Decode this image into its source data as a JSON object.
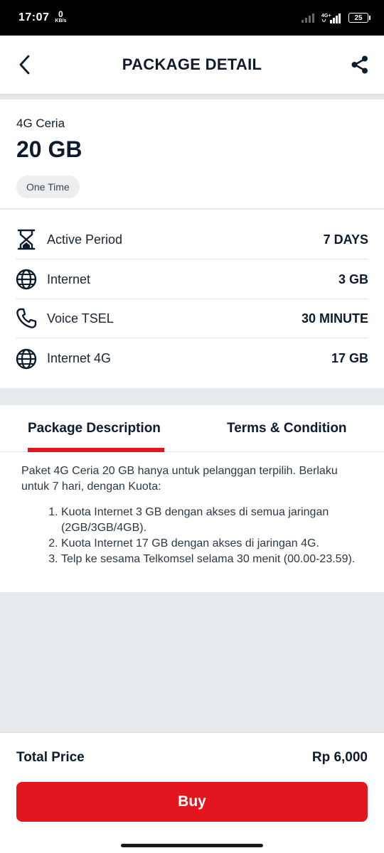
{
  "status_bar": {
    "time": "17:07",
    "speed_value": "0",
    "speed_unit": "KB/s",
    "battery": "25"
  },
  "header": {
    "title": "PACKAGE DETAIL",
    "back_icon": "chevron-left-icon",
    "share_icon": "share-icon"
  },
  "package": {
    "subtitle": "4G Ceria",
    "name": "20 GB",
    "type_chip": "One Time"
  },
  "benefits": [
    {
      "icon": "hourglass-icon",
      "label": "Active Period",
      "value": "7 DAYS"
    },
    {
      "icon": "globe-icon",
      "label": "Internet",
      "value": "3 GB"
    },
    {
      "icon": "phone-icon",
      "label": "Voice TSEL",
      "value": "30 MINUTE"
    },
    {
      "icon": "globe-icon",
      "label": "Internet 4G",
      "value": "17 GB"
    }
  ],
  "tabs": [
    {
      "label": "Package Description",
      "active": true
    },
    {
      "label": "Terms & Condition",
      "active": false
    }
  ],
  "description": {
    "intro": "Paket 4G Ceria 20 GB hanya untuk pelanggan terpilih. Berlaku untuk 7 hari, dengan Kuota:",
    "items": [
      "Kuota Internet 3 GB dengan akses di semua jaringan (2GB/3GB/4GB).",
      "Kuota Internet 17 GB dengan akses di jaringan 4G.",
      "Telp ke sesama Telkomsel selama 30 menit (00.00-23.59)."
    ]
  },
  "footer": {
    "total_label": "Total Price",
    "total_value": "Rp 6,000",
    "buy_label": "Buy"
  },
  "colors": {
    "accent": "#e3151e",
    "text_dark": "#0d1b2e",
    "background": "#e8ebee"
  }
}
